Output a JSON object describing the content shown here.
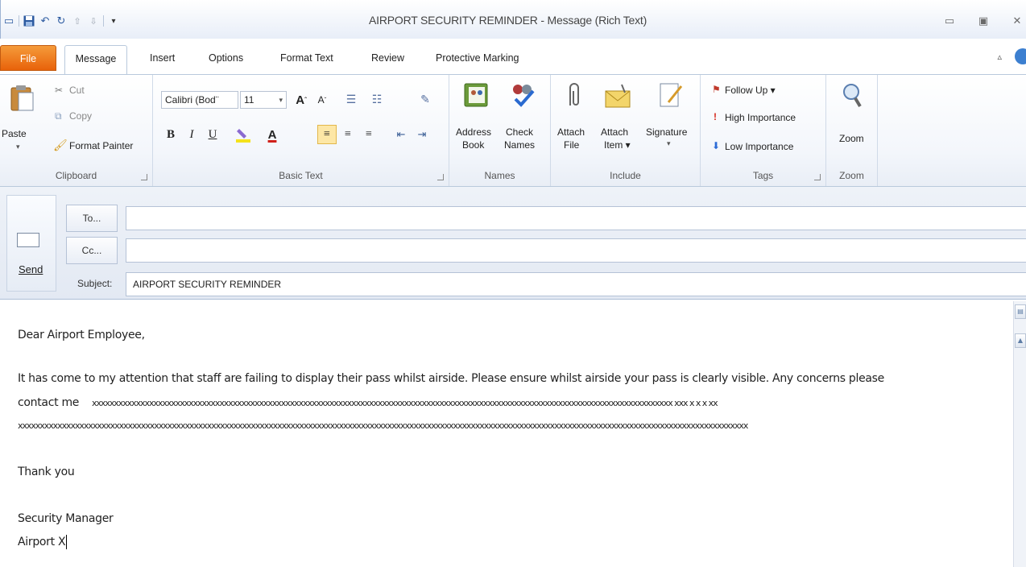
{
  "window": {
    "title": "AIRPORT SECURITY REMINDER  -  Message (Rich Text)"
  },
  "tabs": [
    {
      "label": "File"
    },
    {
      "label": "Message"
    },
    {
      "label": "Insert"
    },
    {
      "label": "Options"
    },
    {
      "label": "Format Text"
    },
    {
      "label": "Review"
    },
    {
      "label": "Protective Marking"
    }
  ],
  "ribbon": {
    "clipboard": {
      "paste": "Paste",
      "cut": "Cut",
      "copy": "Copy",
      "format_painter": "Format Painter",
      "group": "Clipboard"
    },
    "basic_text": {
      "font": "Calibri (Bod¨",
      "size": "11",
      "group": "Basic Text"
    },
    "names": {
      "address_book_1": "Address",
      "address_book_2": "Book",
      "check_names_1": "Check",
      "check_names_2": "Names",
      "group": "Names"
    },
    "include": {
      "attach_file_1": "Attach",
      "attach_file_2": "File",
      "attach_item_1": "Attach",
      "attach_item_2": "Item ▾",
      "signature": "Signature",
      "group": "Include"
    },
    "tags": {
      "follow_up": "Follow Up ▾",
      "high": "High Importance",
      "low": "Low Importance",
      "group": "Tags"
    },
    "zoom": {
      "zoom": "Zoom",
      "group": "Zoom"
    }
  },
  "header": {
    "send": "Send",
    "to_button": "To...",
    "cc_button": "Cc...",
    "to_value": "",
    "cc_value": "",
    "subject_label": "Subject:",
    "subject_value": "AIRPORT SECURITY REMINDER"
  },
  "body": {
    "greeting": "Dear Airport Employee,",
    "para1": "It has come to my attention that staff are failing to display their pass whilst airside. Please ensure whilst airside your pass is clearly visible. Any concerns please",
    "para2_prefix": "contact me",
    "para2_redacted": "xxxxxxxxxxxxxxxxxxxxxxxxxxxxxxxxxxxxxxxxxxxxxxxxxxxxxxxxxxxxxxxxxxxxxxxxxxxxxxxxxxxxxxxxxxxxxxxxxxxxxxxxxxxxxxxxxxxxxxxxxxxxxxxxxxxx xxx x x x xx",
    "para3_redacted": "xxxxxxxxxxxxxxxxxxxxxxxxxxxxxxxxxxxxxxxxxxxxxxxxxxxxxxxxxxxxxxxxxxxxxxxxxxxxxxxxxxxxxxxxxxxxxxxxxxxxxxxxxxxxxxxxxxxxxxxxxxxxxxxxxxxxxxxxxxxxxxxxxxxxxxxxxxxxxxxxxxxxxx",
    "thanks": "Thank you",
    "sig1": "Security Manager",
    "sig2": "Airport X"
  },
  "icons": {
    "save": "save-icon",
    "undo": "undo-icon",
    "redo": "redo-icon",
    "minimize": "minimize-icon",
    "maximize": "maximize-icon",
    "close": "close-icon"
  },
  "colors": {
    "file_tab": "#e8620a",
    "ribbon_border": "#b9c9dc",
    "follow_up_flag": "#c0392b",
    "high_importance": "#d62a1e",
    "low_importance": "#2a6ad6"
  }
}
